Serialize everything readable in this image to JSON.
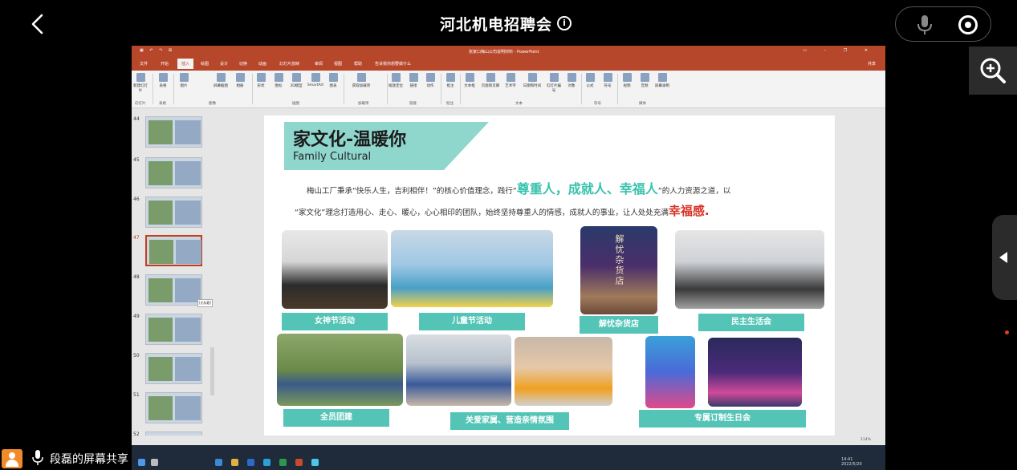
{
  "header": {
    "title": "河北机电招聘会"
  },
  "ppt": {
    "doc_title": "张家口梅山公司说明材料 - PowerPoint",
    "tabs": [
      "文件",
      "开始",
      "插入",
      "绘图",
      "设计",
      "切换",
      "动画",
      "幻灯片放映",
      "审阅",
      "视图",
      "帮助",
      "告诉我你想要做什么"
    ],
    "share": "共享",
    "ribbon_groups": [
      "幻灯片",
      "表格",
      "图像",
      "插图",
      "加载项",
      "链接",
      "批注",
      "文本",
      "符号",
      "媒体"
    ],
    "ribbon_buttons": [
      "新建幻灯片",
      "表格",
      "图片",
      "屏幕截图",
      "相册",
      "形状",
      "图标",
      "3D模型",
      "SmartArt",
      "图表",
      "获取加载项",
      "我的加载项",
      "缩放定位",
      "链接",
      "动作",
      "批注",
      "文本框",
      "页眉和页脚",
      "艺术字",
      "日期和时间",
      "幻灯片编号",
      "对象",
      "公式",
      "符号",
      "视频",
      "音频",
      "屏幕录制"
    ],
    "thumb_numbers": [
      "44",
      "45",
      "46",
      "47",
      "48",
      "49",
      "50",
      "51",
      "52"
    ],
    "thumb_label": "[无标题]"
  },
  "slide": {
    "title": "家文化-温暖你",
    "subtitle": "Family Cultural",
    "p1_a": "梅山工厂秉承“快乐人生，吉利相伴！”的核心价值理念，践行“",
    "p1_hl": "尊重人，成就人、幸福人",
    "p1_b": "”的人力资源之道，以",
    "p2_a": "“家文化”理念打造用心、走心、暖心，心心相印的团队，始终坚持尊重人的情感，成就人的事业，让人处处充满",
    "p2_hl": "幸福感.",
    "captions": [
      "女神节活动",
      "儿童节活动",
      "解忧杂货店",
      "民主生活会",
      "全员团建",
      "关爱家属、营造亲情氛围",
      "专属订制生日会"
    ],
    "poster_text": "解忧杂货店"
  },
  "status": {
    "zoom": "114%"
  },
  "taskbar": {
    "time": "14:41",
    "date": "2022/5/20"
  },
  "share_label": "段磊的屏幕共享"
}
